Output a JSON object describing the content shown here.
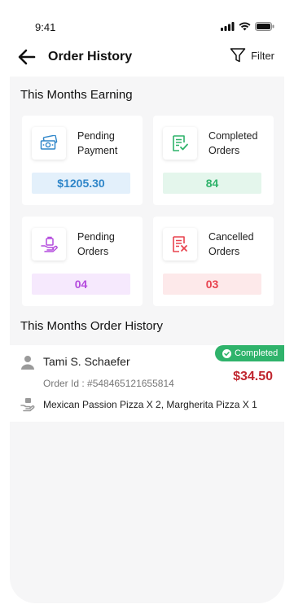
{
  "status_bar": {
    "time": "9:41"
  },
  "header": {
    "title": "Order History",
    "filter_label": "Filter"
  },
  "earnings": {
    "title": "This Months Earning",
    "cards": [
      {
        "label_line1": "Pending",
        "label_line2": "Payment",
        "value": "$1205.30",
        "icon": "cash-icon",
        "color": "#2f86c9"
      },
      {
        "label_line1": "Completed",
        "label_line2": "Orders",
        "value": "84",
        "icon": "completed-receipt-icon",
        "color": "#2fb36b"
      },
      {
        "label_line1": "Pending",
        "label_line2": "Orders",
        "value": "04",
        "icon": "pending-bag-icon",
        "color": "#b44bdd"
      },
      {
        "label_line1": "Cancelled",
        "label_line2": "Orders",
        "value": "03",
        "icon": "cancelled-receipt-icon",
        "color": "#e8434f"
      }
    ]
  },
  "history": {
    "title": "This Months Order History",
    "orders": [
      {
        "customer": "Tami S. Schaefer",
        "order_id": "Order Id : #548465121655814",
        "items": "Mexican Passion Pizza X 2, Margherita Pizza X 1",
        "status": "Completed",
        "price": "$34.50",
        "status_color": "#2fb36b"
      }
    ]
  }
}
